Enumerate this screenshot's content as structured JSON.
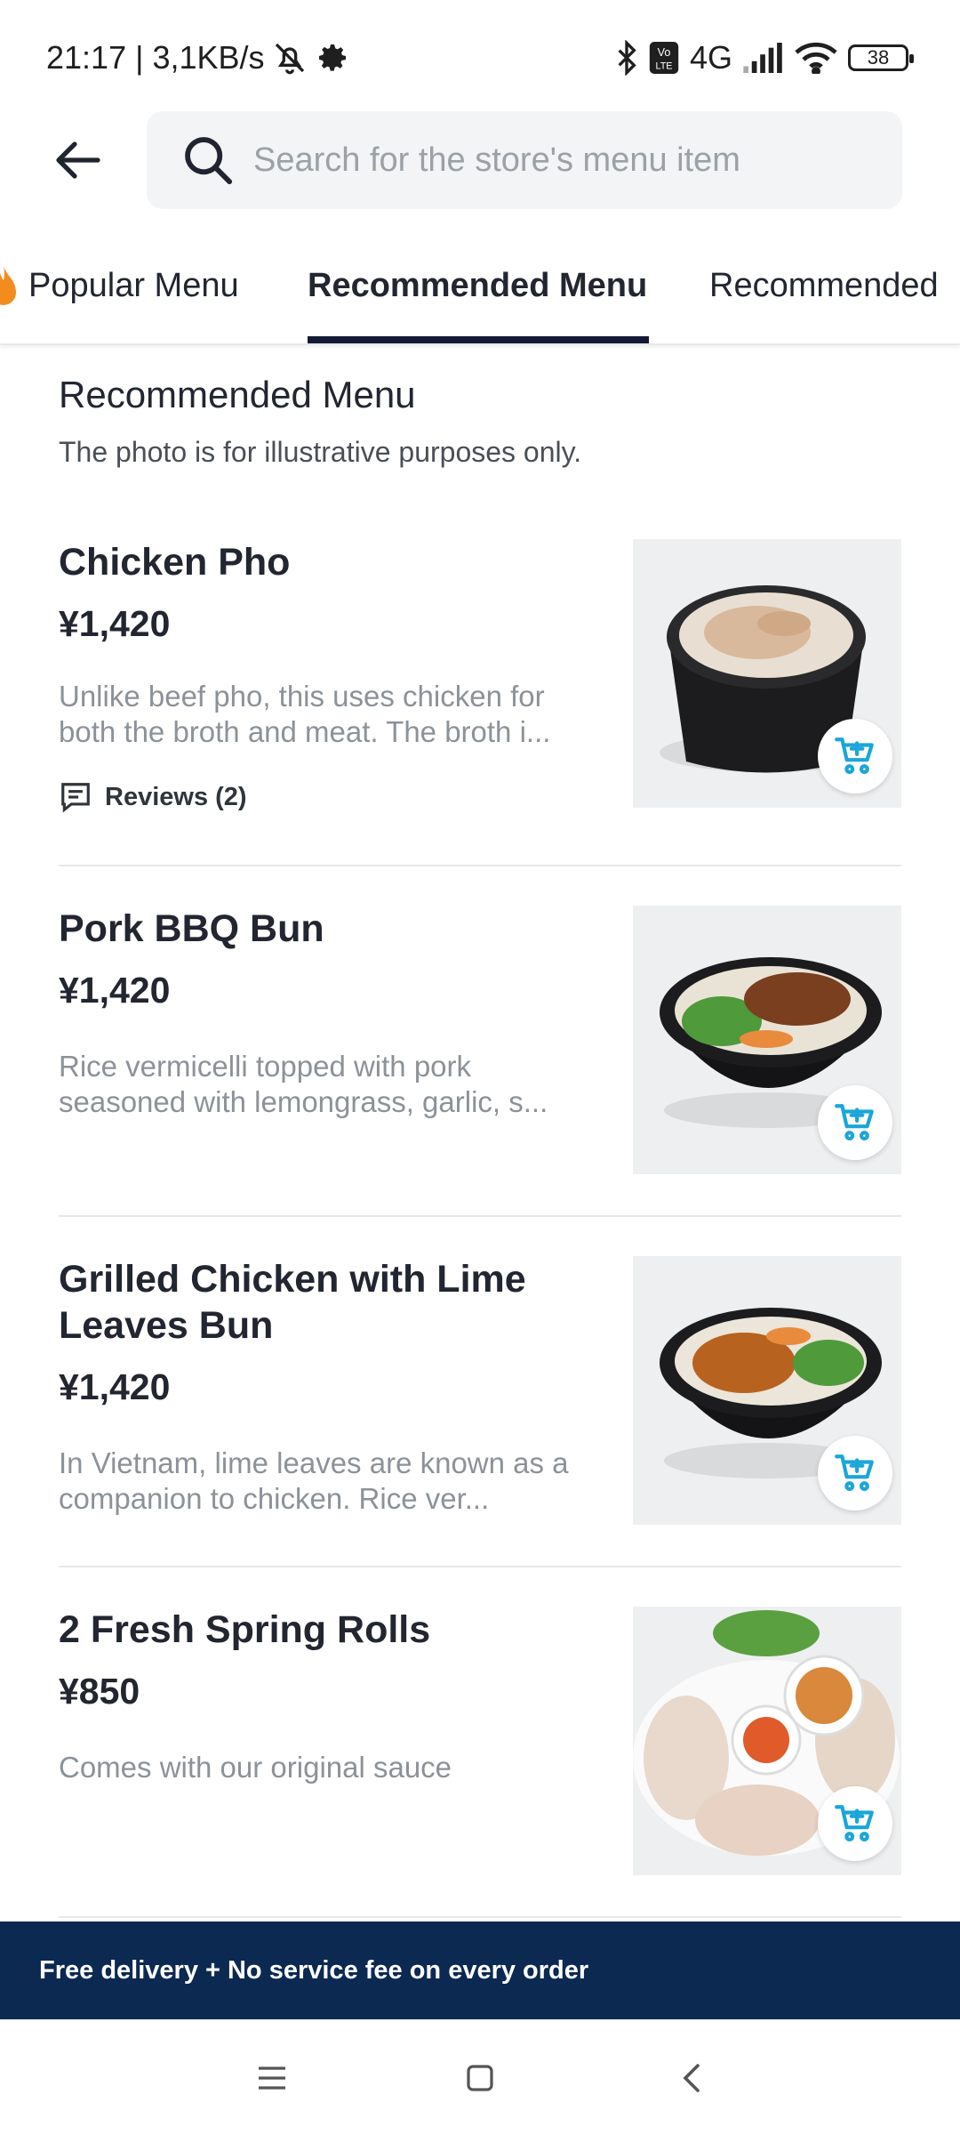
{
  "status_bar": {
    "time_speed": "21:17 | 3,1KB/s",
    "network": "4G",
    "battery": "38"
  },
  "search": {
    "placeholder": "Search for the store's menu item"
  },
  "tabs": [
    {
      "label": "Popular Menu",
      "active": false
    },
    {
      "label": "Recommended Menu",
      "active": true
    },
    {
      "label": "Recommended",
      "active": false
    }
  ],
  "section": {
    "title": "Recommended Menu",
    "note": "The photo is for illustrative purposes only."
  },
  "items": [
    {
      "name": "Chicken Pho",
      "price": "¥1,420",
      "description": "Unlike beef pho, this uses chicken for both the broth and meat. The broth i...",
      "reviews": "Reviews (2)"
    },
    {
      "name": "Pork BBQ Bun",
      "price": "¥1,420",
      "description": "Rice vermicelli topped with pork seasoned with lemongrass, garlic, s..."
    },
    {
      "name": "Grilled Chicken with Lime Leaves Bun",
      "price": "¥1,420",
      "description": "In Vietnam, lime leaves are known as a companion to chicken. Rice ver..."
    },
    {
      "name": "2 Fresh Spring Rolls",
      "price": "¥850",
      "description": "Comes with our original sauce"
    }
  ],
  "promo": {
    "text": "Free delivery + No service fee on every order"
  },
  "colors": {
    "accent_cart": "#1aa6d9",
    "tab_underline": "#141a33",
    "promo_bg": "#0c2952"
  }
}
